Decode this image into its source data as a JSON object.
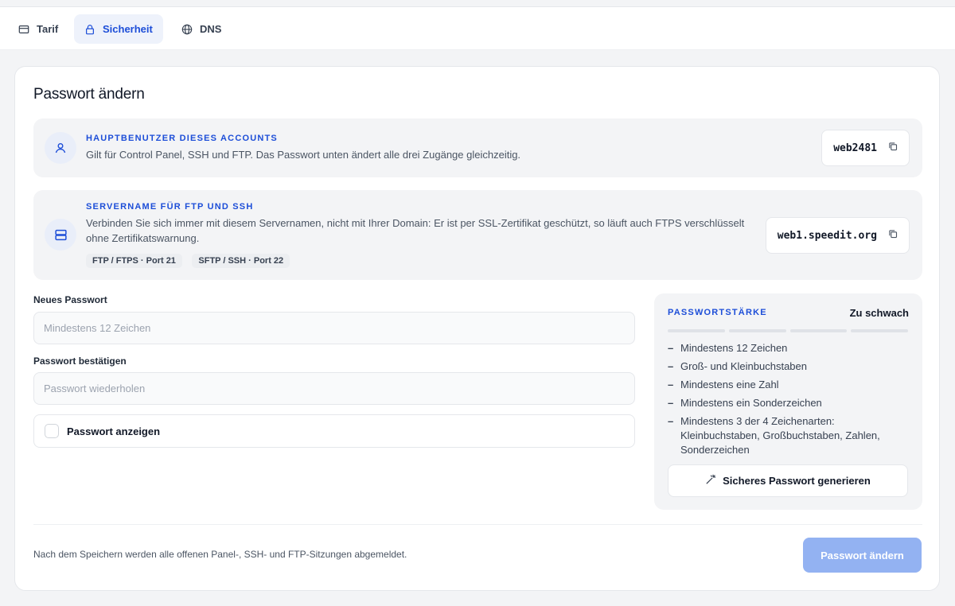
{
  "tabs": [
    {
      "label": "Tarif",
      "icon": "card-icon",
      "active": false
    },
    {
      "label": "Sicherheit",
      "icon": "lock-icon",
      "active": true
    },
    {
      "label": "DNS",
      "icon": "globe-icon",
      "active": false
    }
  ],
  "card": {
    "title": "Passwort ändern",
    "main_user": {
      "kicker": "HAUPTBENUTZER DIESES ACCOUNTS",
      "text": "Gilt für Control Panel, SSH und FTP. Das Passwort unten ändert alle drei Zugänge gleichzeitig.",
      "value": "web2481",
      "icon": "user-icon",
      "copy_icon": "copy-icon"
    },
    "server": {
      "kicker": "SERVERNAME FÜR FTP UND SSH",
      "text_line1": "Verbinden Sie sich immer mit diesem Servernamen, nicht mit Ihrer Domain: Er ist per SSL-Zertifikat geschützt, so läuft auch FTPS verschlüsselt",
      "text_line2": "ohne Zertifikatswarnung.",
      "chips": [
        "FTP / FTPS · Port 21",
        "SFTP / SSH · Port 22"
      ],
      "value": "web1.speedit.org",
      "icon": "server-icon",
      "copy_icon": "copy-icon"
    },
    "form": {
      "new_label": "Neues Passwort",
      "new_placeholder": "Mindestens 12 Zeichen",
      "new_value": "",
      "confirm_label": "Passwort bestätigen",
      "confirm_placeholder": "Passwort wiederholen",
      "confirm_value": "",
      "show_label": "Passwort anzeigen",
      "show_checked": false
    },
    "strength": {
      "kicker": "PASSWORTSTÄRKE",
      "status": "Zu schwach",
      "filled_segments": 0,
      "total_segments": 4,
      "rules": [
        "Mindestens 12 Zeichen",
        "Groß- und Kleinbuchstaben",
        "Mindestens eine Zahl",
        "Mindestens ein Sonderzeichen",
        "Mindestens 3 der 4 Zeichenarten: Kleinbuchstaben, Großbuchstaben, Zahlen, Sonderzeichen"
      ],
      "rule_marker": "–",
      "generate_label": "Sicheres Passwort generieren",
      "generate_icon": "magic-wand-icon"
    },
    "footer": {
      "note": "Nach dem Speichern werden alle offenen Panel-, SSH- und FTP-Sitzungen abgemeldet.",
      "submit_label": "Passwort ändern"
    }
  },
  "colors": {
    "accent": "#1d4ed8",
    "accent_bg": "#eef2fb",
    "submit_disabled": "#93b2f2",
    "panel_bg": "#f3f4f6"
  }
}
